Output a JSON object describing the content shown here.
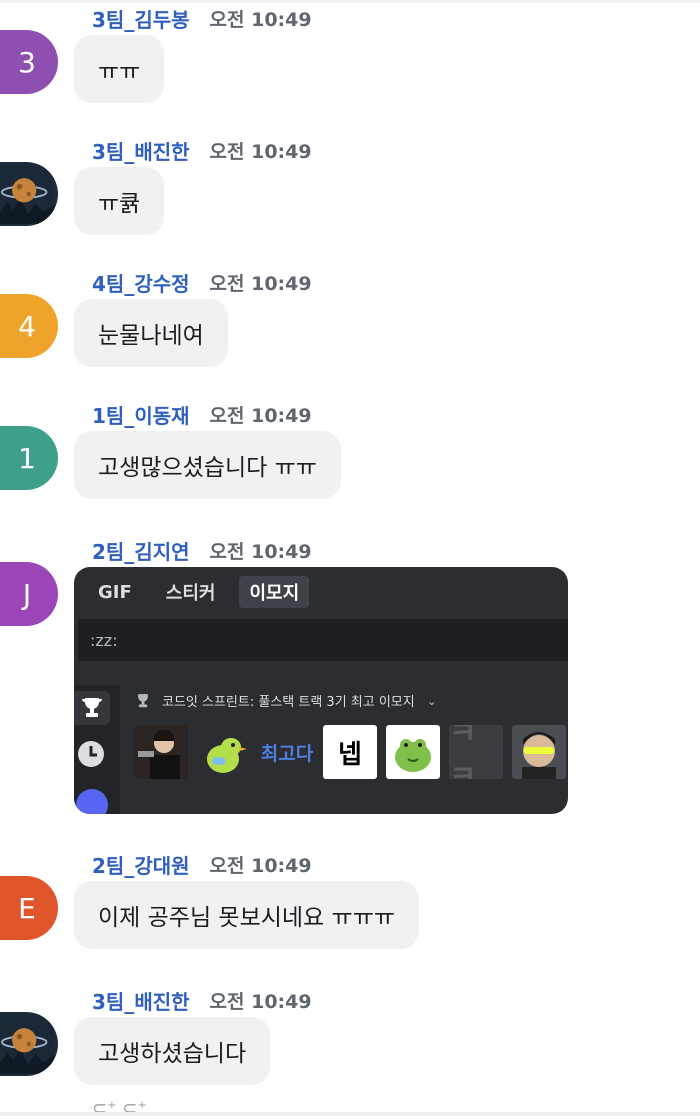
{
  "messages": [
    {
      "author": "3팀_김두봉",
      "time": "오전 10:49",
      "text": "ㅠㅠ",
      "avatar_text": "3",
      "avatar_color": "#8e4fb0"
    },
    {
      "author": "3팀_배진한",
      "time": "오전 10:49",
      "text": "ㅠ큙",
      "avatar_text": "",
      "avatar_color": "#1d2b3a"
    },
    {
      "author": "4팀_강수정",
      "time": "오전 10:49",
      "text": "눈물나네여",
      "avatar_text": "4",
      "avatar_color": "#f0a32a"
    },
    {
      "author": "1팀_이동재",
      "time": "오전 10:49",
      "text": "고생많으셨습니다 ㅠㅠ",
      "avatar_text": "1",
      "avatar_color": "#3fa08a"
    },
    {
      "author": "2팀_김지연",
      "time": "오전 10:49",
      "text": "",
      "avatar_text": "J",
      "avatar_color": "#9a45b8"
    },
    {
      "author": "2팀_강대원",
      "time": "오전 10:49",
      "text": "이제 공주님 못보시네요 ㅠㅠㅠ",
      "avatar_text": "E",
      "avatar_color": "#e0562a"
    },
    {
      "author": "3팀_배진한",
      "time": "오전 10:49",
      "text": "고생하셨습니다",
      "avatar_text": "",
      "avatar_color": "#1d2b3a"
    }
  ],
  "picker": {
    "tabs": [
      "GIF",
      "스티커",
      "이모지"
    ],
    "active_tab": "이모지",
    "search_value": ":zz:",
    "category_label": "코드잇 스프린트: 풀스택 트랙 3기 최고 이모지",
    "sidebar_icons": [
      "trophy-icon",
      "clock-icon",
      "server-icon"
    ],
    "emojis": [
      "person-aiming-emoji",
      "green-bird-emoji",
      "최고다",
      "넵",
      "green-frog-emoji",
      "ㅋㅋ",
      "sunglasses-person-emoji"
    ]
  },
  "reactions_hint": "⊂⁺ ⊂⁺"
}
